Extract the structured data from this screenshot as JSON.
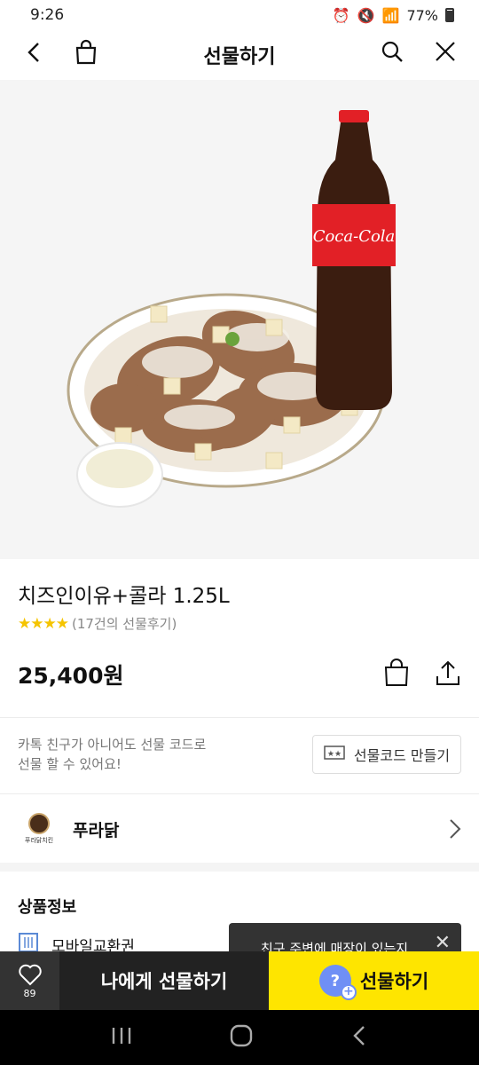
{
  "status": {
    "time": "9:26",
    "battery": "77%"
  },
  "header": {
    "title": "선물하기"
  },
  "product": {
    "name": "치즈인이유+콜라 1.25L",
    "stars": "★★★★",
    "review": "(17건의 선물후기)",
    "price": "25,400원",
    "bottle_label": "Coca-Cola"
  },
  "gift_code": {
    "desc_line1": "카톡 친구가 아니어도 선물 코드로",
    "desc_line2": "선물 할 수 있어요!",
    "button": "선물코드 만들기"
  },
  "brand": {
    "name": "푸라닭",
    "logo_text": "푸라닭치킨"
  },
  "info": {
    "section_title": "상품정보",
    "voucher": "모바일교환권"
  },
  "toast": {
    "text": "친구 주변에 매장이 있는지"
  },
  "bottom": {
    "wish_count": "89",
    "self_gift": "나에게 선물하기",
    "gift": "선물하기"
  },
  "colors": {
    "accent": "#fee500",
    "dark": "#222222",
    "star": "#f5c400"
  }
}
